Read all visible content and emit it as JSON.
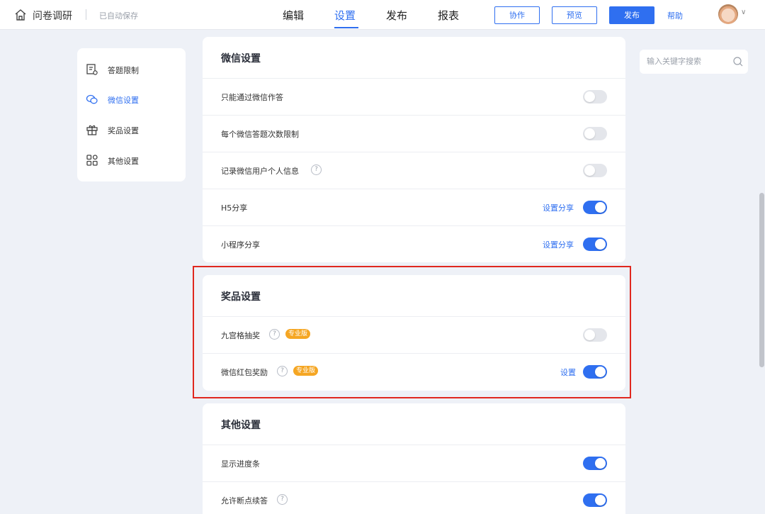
{
  "header": {
    "app_title": "问卷调研",
    "autosave": "已自动保存",
    "tabs": [
      {
        "label": "编辑"
      },
      {
        "label": "设置"
      },
      {
        "label": "发布"
      },
      {
        "label": "报表"
      }
    ],
    "active_tab": "设置",
    "collaborate_label": "协作",
    "preview_label": "预览",
    "publish_label": "发布",
    "help_label": "帮助"
  },
  "sidebar": {
    "items": [
      {
        "label": "答题限制",
        "icon": "document-settings-icon"
      },
      {
        "label": "微信设置",
        "icon": "wechat-icon"
      },
      {
        "label": "奖品设置",
        "icon": "gift-icon"
      },
      {
        "label": "其他设置",
        "icon": "grid-icon"
      }
    ],
    "active": "微信设置"
  },
  "search": {
    "placeholder": "输入关键字搜索"
  },
  "wechat_section": {
    "title": "微信设置",
    "rows": [
      {
        "label": "只能通过微信作答",
        "enabled": false
      },
      {
        "label": "每个微信答题次数限制",
        "enabled": false
      },
      {
        "label": "记录微信用户个人信息",
        "help": "?",
        "enabled": false
      },
      {
        "label": "H5分享",
        "link": "设置分享",
        "enabled": true
      },
      {
        "label": "小程序分享",
        "link": "设置分享",
        "enabled": true
      }
    ]
  },
  "prize_section": {
    "title": "奖品设置",
    "rows": [
      {
        "label": "九宫格抽奖",
        "help": "?",
        "badge": "专业版",
        "enabled": false
      },
      {
        "label": "微信红包奖励",
        "help": "?",
        "badge": "专业版",
        "link": "设置",
        "enabled": true
      }
    ]
  },
  "other_section": {
    "title": "其他设置",
    "rows": [
      {
        "label": "显示进度条",
        "enabled": true
      },
      {
        "label": "允许断点续答",
        "help": "?",
        "enabled": true
      }
    ]
  },
  "colors": {
    "accent": "#2f6ff0",
    "highlight": "#e0281f",
    "pro_badge": "#f5a623",
    "background": "#eef1f7"
  }
}
